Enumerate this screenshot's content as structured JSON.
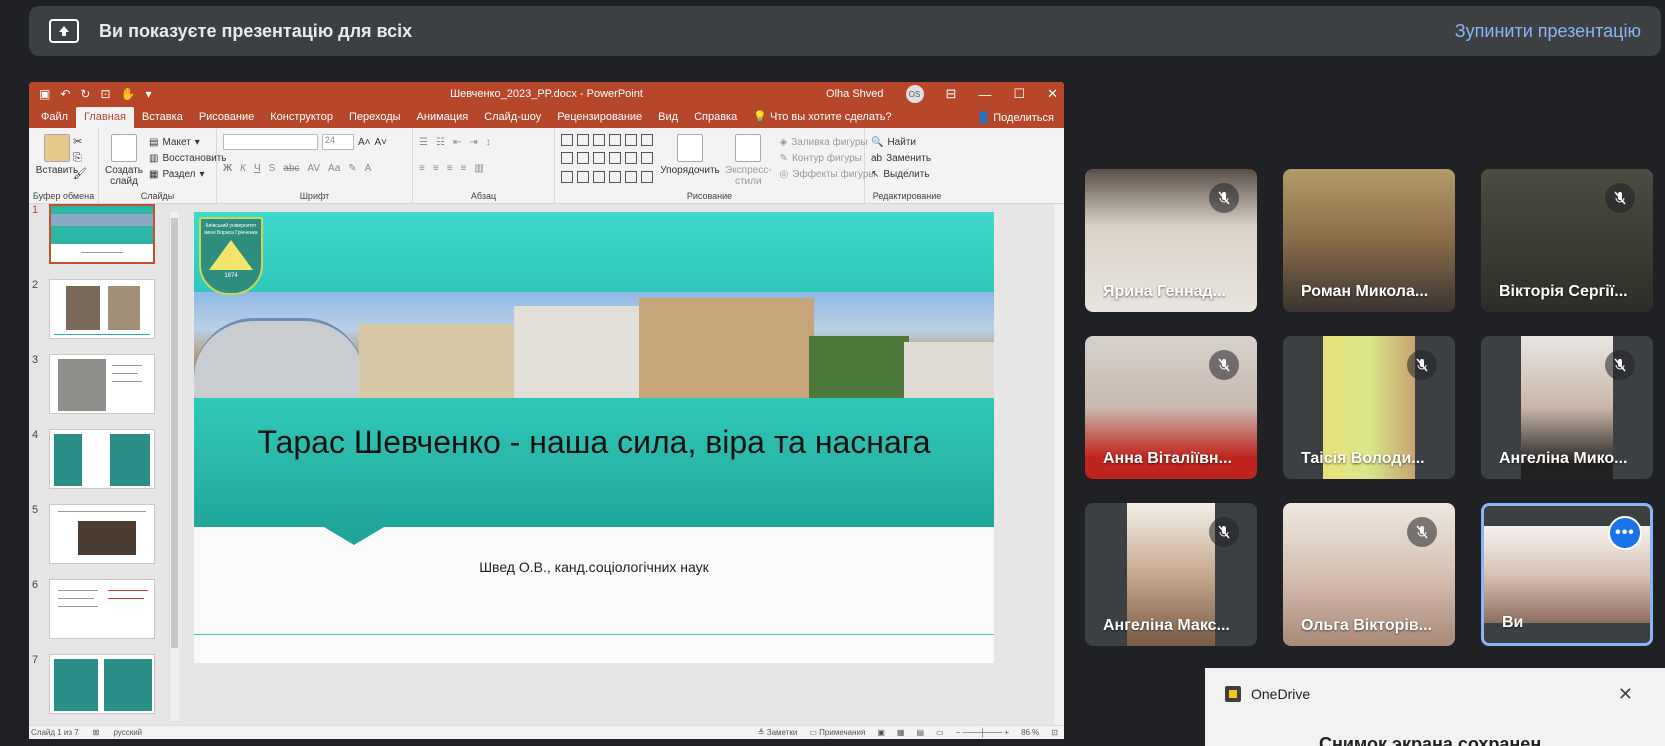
{
  "banner": {
    "text": "Ви показуєте презентацію для всіх",
    "stop_label": "Зупинити презентацію"
  },
  "ppt": {
    "doc_title": "Шевченко_2023_PP.docx  -  PowerPoint",
    "user_name": "Olha Shved",
    "user_initials": "OS",
    "menu": [
      "Файл",
      "Главная",
      "Вставка",
      "Рисование",
      "Конструктор",
      "Переходы",
      "Анимация",
      "Слайд-шоу",
      "Рецензирование",
      "Вид",
      "Справка",
      "Что вы хотите сделать?"
    ],
    "share_label": "Поделиться",
    "ribbon": {
      "paste": "Вставить",
      "clipboard_group": "Буфер обмена",
      "create_slide": "Создать слайд",
      "layout": "Макет",
      "reset": "Восстановить",
      "section": "Раздел",
      "slides_group": "Слайды",
      "font_size": "24",
      "font_group": "Шрифт",
      "paragraph_group": "Абзац",
      "arrange": "Упорядочить",
      "express_styles": "Экспресс-стили",
      "shape_fill": "Заливка фигуры",
      "shape_outline": "Контур фигуры",
      "shape_effects": "Эффекты фигуры",
      "drawing_group": "Рисование",
      "find": "Найти",
      "replace": "Заменить",
      "select": "Выделить",
      "editing_group": "Редактирование"
    },
    "thumb_numbers": [
      "1",
      "2",
      "3",
      "4",
      "5",
      "6",
      "7"
    ],
    "slide": {
      "logo_text": "Київський університет імені Бориса Грінченка",
      "logo_year": "1874",
      "title": "Тарас Шевченко - наша сила, віра та наснага",
      "subtitle": "Швед О.В., канд.соціологічних наук"
    },
    "status": {
      "slide_count": "Слайд 1 из 7",
      "language": "русский",
      "notes": "Заметки",
      "comments": "Примечания",
      "zoom": "86 %"
    }
  },
  "participants": [
    {
      "name": "Ярина Геннад..."
    },
    {
      "name": "Роман Микола..."
    },
    {
      "name": "Вікторія Сергії..."
    },
    {
      "name": "Анна Віталіївн..."
    },
    {
      "name": "Таісія Володи..."
    },
    {
      "name": "Ангеліна Мико..."
    },
    {
      "name": "Ангеліна Макс..."
    },
    {
      "name": "Ольга Вікторів..."
    },
    {
      "name": "Ви"
    }
  ],
  "toast": {
    "app": "OneDrive",
    "message": "Снимок экрана сохранен"
  },
  "colors": {
    "accent_blue": "#8ab4f8",
    "ppt_red": "#b7472a",
    "slide_teal": "#2fc8b8"
  }
}
